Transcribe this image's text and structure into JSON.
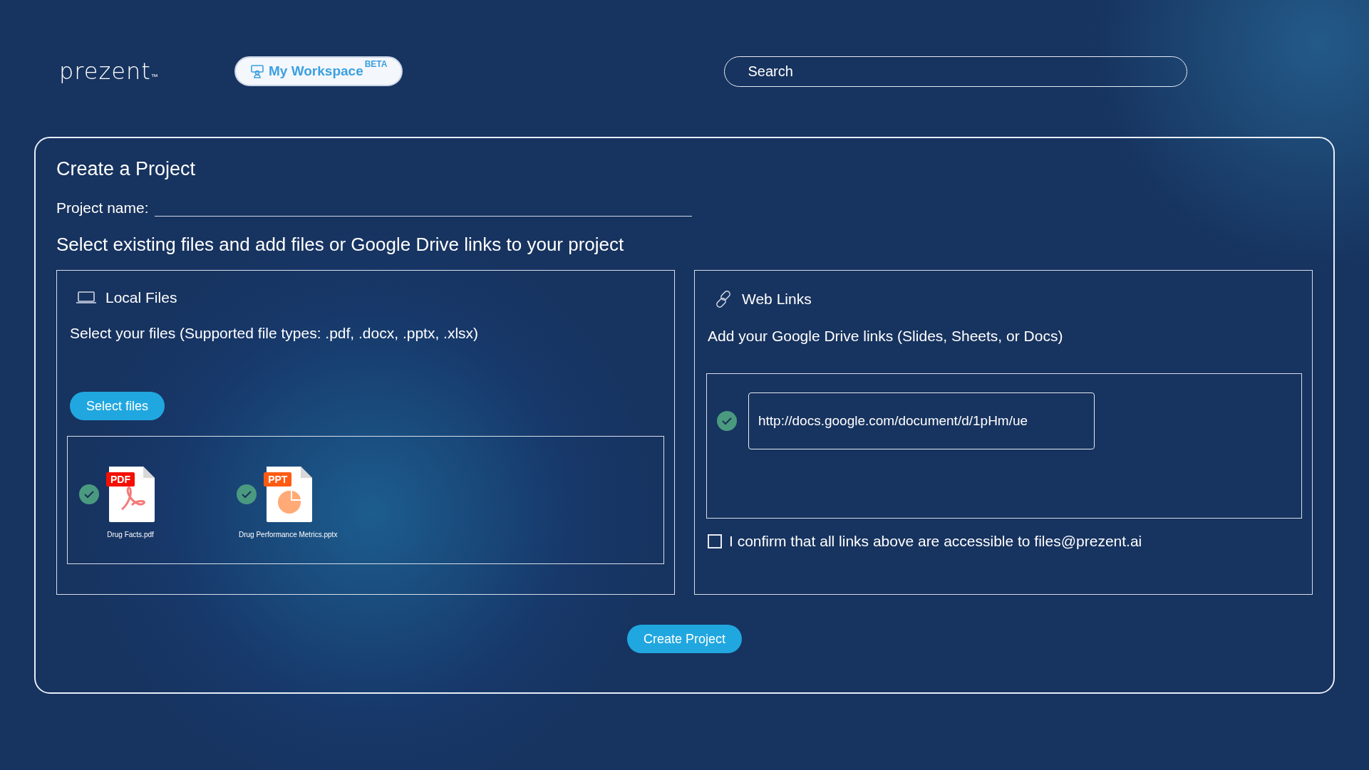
{
  "header": {
    "logo": "prezent",
    "logo_mark": "™",
    "workspace_button": {
      "label": "My Workspace",
      "badge": "BETA"
    },
    "search": {
      "placeholder": "Search"
    }
  },
  "card": {
    "title": "Create a Project",
    "project_name": {
      "label": "Project name:"
    },
    "instructions": "Select existing files and add files or Google Drive links to your project",
    "local_files": {
      "title": "Local Files",
      "description": "Select your files (Supported file types: .pdf, .docx, .pptx, .xlsx)",
      "button": "Select files",
      "files": [
        {
          "kind": "pdf",
          "badge": "PDF",
          "name": "Drug Facts.pdf",
          "uploaded": true
        },
        {
          "kind": "pptx",
          "badge": "PPT",
          "name": "Drug Performance Metrics.pptx",
          "uploaded": true
        }
      ]
    },
    "web_links": {
      "title": "Web Links",
      "description": "Add your Google Drive links (Slides, Sheets, or Docs)",
      "links": [
        {
          "value": "http://docs.google.com/document/d/1pHm/ue",
          "valid": true
        }
      ],
      "confirm": {
        "label": "I confirm that all links above are accessible to files@prezent.ai",
        "checked": false
      }
    },
    "create_button": "Create Project"
  }
}
